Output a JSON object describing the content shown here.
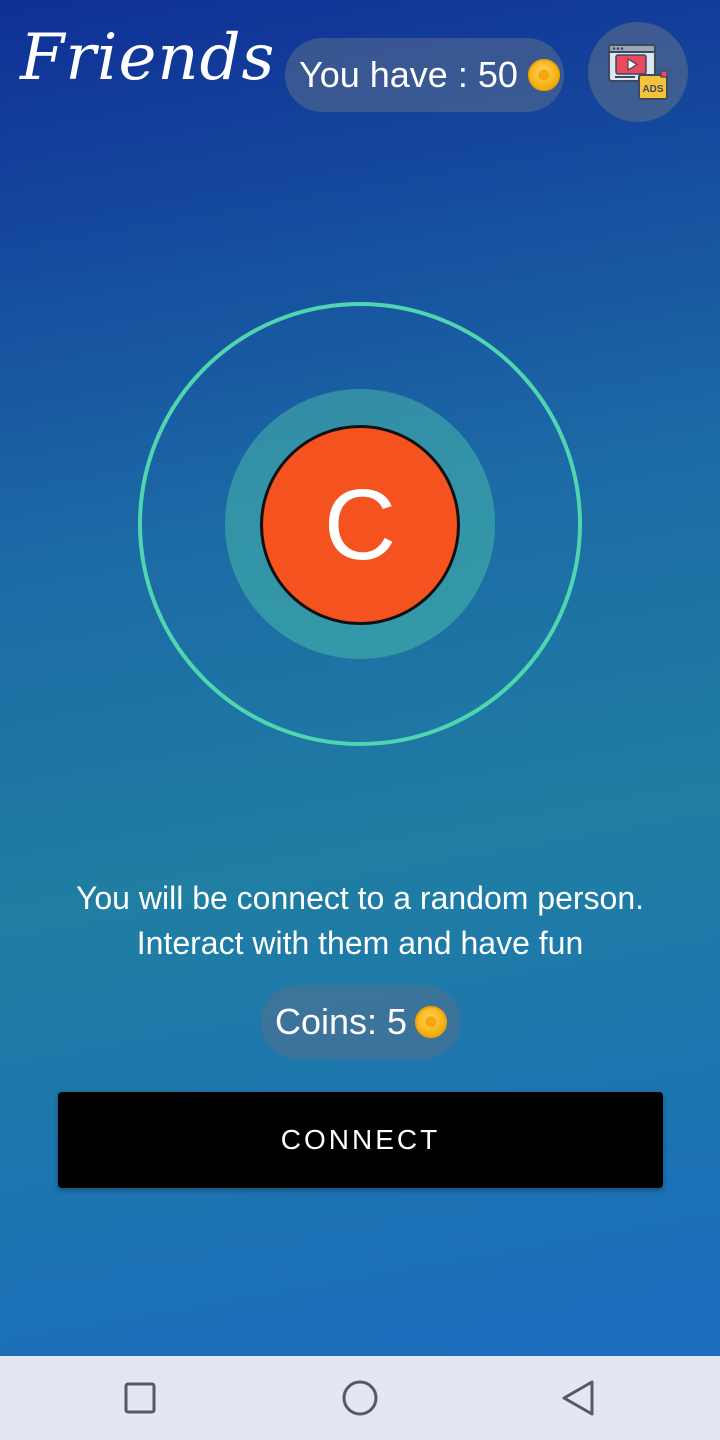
{
  "app": {
    "logo_text": "Friends"
  },
  "header": {
    "balance_text": "You have : 50",
    "balance_icon": "coin-icon",
    "ads_icon": "ads-video-icon"
  },
  "avatar": {
    "letter": "C",
    "color": "#f4521e"
  },
  "message": {
    "line1": "You will be connect to a random person.",
    "line2": "Interact with them and have fun"
  },
  "cost": {
    "text": "Coins: 5",
    "icon": "coin-icon"
  },
  "connect_button": {
    "label": "CONNECT"
  },
  "nav": {
    "recent_icon": "square-icon",
    "home_icon": "circle-icon",
    "back_icon": "triangle-back-icon"
  },
  "colors": {
    "ring": "#4fd6b0",
    "button_bg": "#000000",
    "coin": "#f7b21a"
  }
}
